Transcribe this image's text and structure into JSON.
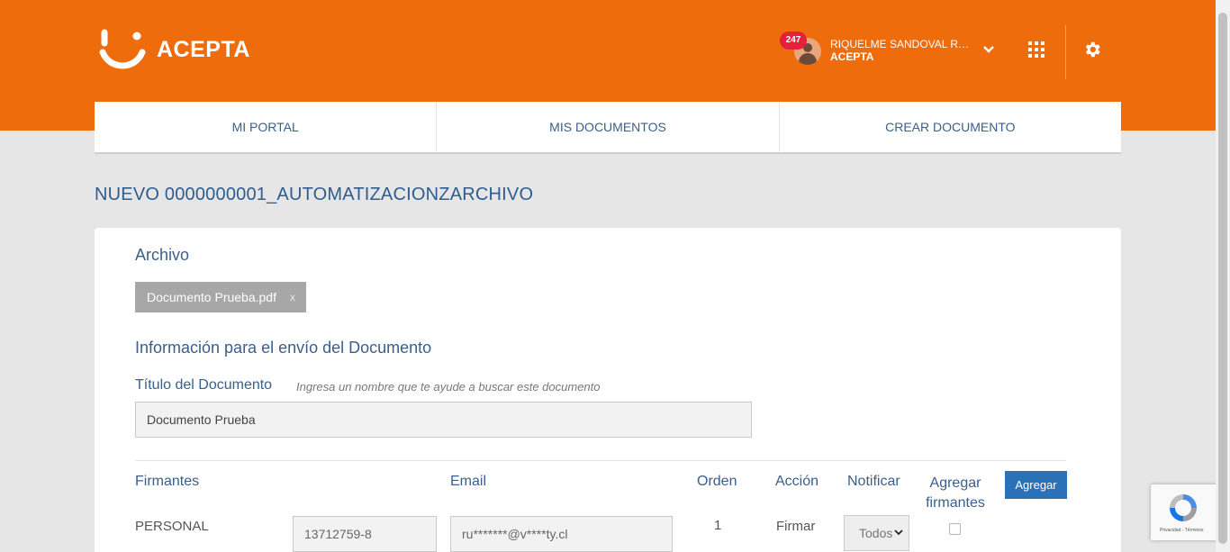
{
  "header": {
    "logo_text": "ACEPTA",
    "notifications_count": "247",
    "user_name": "RIQUELME SANDOVAL RU...",
    "user_org": "ACEPTA"
  },
  "nav": {
    "items": [
      "MI PORTAL",
      "MIS DOCUMENTOS",
      "CREAR DOCUMENTO"
    ]
  },
  "page": {
    "title": "NUEVO 0000000001_AUTOMATIZACIONZARCHIVO"
  },
  "archivo": {
    "heading": "Archivo",
    "file_name": "Documento Prueba.pdf",
    "remove": "x"
  },
  "info": {
    "heading": "Información para el envío del Documento",
    "title_label": "Título del Documento",
    "title_hint": "Ingresa un nombre que te ayude a buscar este documento",
    "title_value": "Documento Prueba"
  },
  "signers": {
    "headers": {
      "firmantes": "Firmantes",
      "email": "Email",
      "orden": "Orden",
      "accion": "Acción",
      "notificar": "Notificar",
      "agregar_firmantes": "Agregar firmantes"
    },
    "add_button": "Agregar",
    "rows": [
      {
        "type": "PERSONAL",
        "rut": "13712759-8",
        "email": "ru*******@v****ty.cl",
        "order": "1",
        "action": "Firmar",
        "notify": "Todos"
      }
    ]
  },
  "recaptcha": {
    "footer": "Privacidad - Términos"
  },
  "colors": {
    "brand_orange": "#ee6c0b",
    "primary_blue": "#2a71b8",
    "badge_red": "#e5203b"
  }
}
